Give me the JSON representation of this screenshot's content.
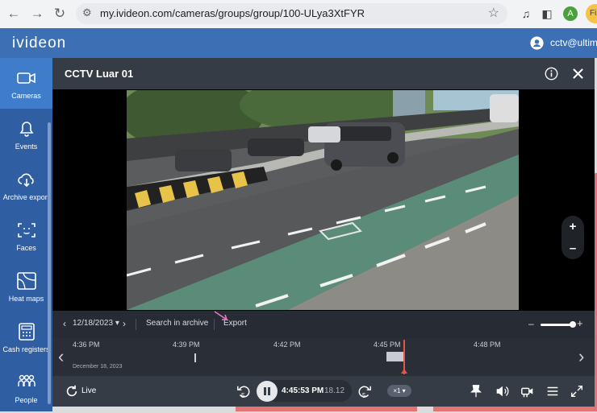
{
  "browser": {
    "url": "my.ivideon.com/cameras/groups/group/100-ULya3XtFYR",
    "avatar_letter": "A",
    "profile_label": "Fi"
  },
  "app": {
    "logo": "ivideon",
    "user_email": "cctv@ultima"
  },
  "sidebar": {
    "items": [
      {
        "label": "Cameras",
        "icon": "camera-icon"
      },
      {
        "label": "Events",
        "icon": "bell-icon"
      },
      {
        "label": "Archive export",
        "icon": "cloud-download-icon"
      },
      {
        "label": "Faces",
        "icon": "face-icon"
      },
      {
        "label": "Heat maps",
        "icon": "heatmap-icon"
      },
      {
        "label": "Cash registers",
        "icon": "cash-register-icon"
      },
      {
        "label": "People",
        "icon": "people-icon"
      }
    ]
  },
  "player": {
    "title": "CCTV Luar 01",
    "date": "12/18/2023",
    "search_label": "Search in archive",
    "export_label": "Export",
    "timeline": {
      "labels": [
        "4:36 PM",
        "4:39 PM",
        "4:42 PM",
        "4:45 PM",
        "4:48 PM"
      ],
      "date_label": "December 18, 2023"
    },
    "live_label": "Live",
    "rewind_seconds": "5",
    "forward_seconds": "5",
    "current_time": "4:45:53 PM",
    "seconds_fraction": "18.12",
    "speed": "×1"
  },
  "colors": {
    "header": "#3d6fb4",
    "sidebar": "#2f5fa2",
    "sidebar_active": "#3f7cc9",
    "playhead": "#e5534b"
  }
}
